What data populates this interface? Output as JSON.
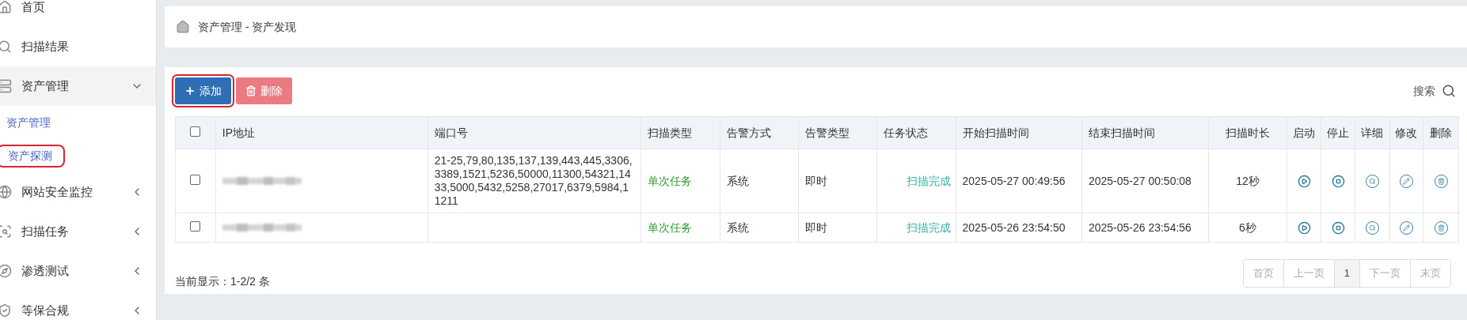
{
  "sidebar": {
    "items": [
      {
        "label": "首页",
        "kind": "link",
        "expanded": false
      },
      {
        "label": "扫描结果",
        "kind": "link",
        "expanded": false
      },
      {
        "label": "资产管理",
        "kind": "group",
        "expanded": true,
        "children": [
          {
            "label": "资产管理",
            "annotated": false
          },
          {
            "label": "资产探测",
            "annotated": true
          }
        ]
      },
      {
        "label": "网站安全监控",
        "kind": "group",
        "expanded": false
      },
      {
        "label": "扫描任务",
        "kind": "group",
        "expanded": false
      },
      {
        "label": "渗透测试",
        "kind": "group",
        "expanded": false
      },
      {
        "label": "等保合规",
        "kind": "group",
        "expanded": false
      }
    ]
  },
  "breadcrumb": "资产管理 - 资产发现",
  "toolbar": {
    "buttons": [
      {
        "label": "添加",
        "kind": "add",
        "annotated": true
      },
      {
        "label": "删除",
        "kind": "delete",
        "annotated": false
      }
    ],
    "search_label": "搜索"
  },
  "table": {
    "select_all": {
      "checked": false
    },
    "columns": [
      "IP地址",
      "端口号",
      "扫描类型",
      "告警方式",
      "告警类型",
      "任务状态",
      "开始扫描时间",
      "结束扫描时间",
      "扫描时长",
      "启动",
      "停止",
      "详细",
      "修改",
      "删除"
    ],
    "rows": [
      {
        "checked": false,
        "ip_redacted": true,
        "ports": "21-25,79,80,135,137,139,443,445,3306,3389,1521,5236,50000,11300,54321,1433,5000,5432,5258,27017,6379,5984,11211",
        "scan_type": "单次任务",
        "alert_method": "系统",
        "alert_type": "即时",
        "status": "扫描完成",
        "start": "2025-05-27 00:49:56",
        "end": "2025-05-27 00:50:08",
        "duration": "12秒"
      },
      {
        "checked": false,
        "ip_redacted": true,
        "scan_type": "单次任务",
        "alert_method": "系统",
        "alert_type": "即时",
        "status": "扫描完成",
        "start": "2025-05-26 23:54:50",
        "end": "2025-05-26 23:54:56",
        "duration": "6秒"
      }
    ]
  },
  "footer": {
    "summary": "当前显示：1-2/2 条",
    "pagination": [
      {
        "label": "首页",
        "selected": false
      },
      {
        "label": "上一页",
        "selected": false
      },
      {
        "label": "1",
        "selected": true
      },
      {
        "label": "下一页",
        "selected": false
      },
      {
        "label": "末页",
        "selected": false
      }
    ]
  }
}
